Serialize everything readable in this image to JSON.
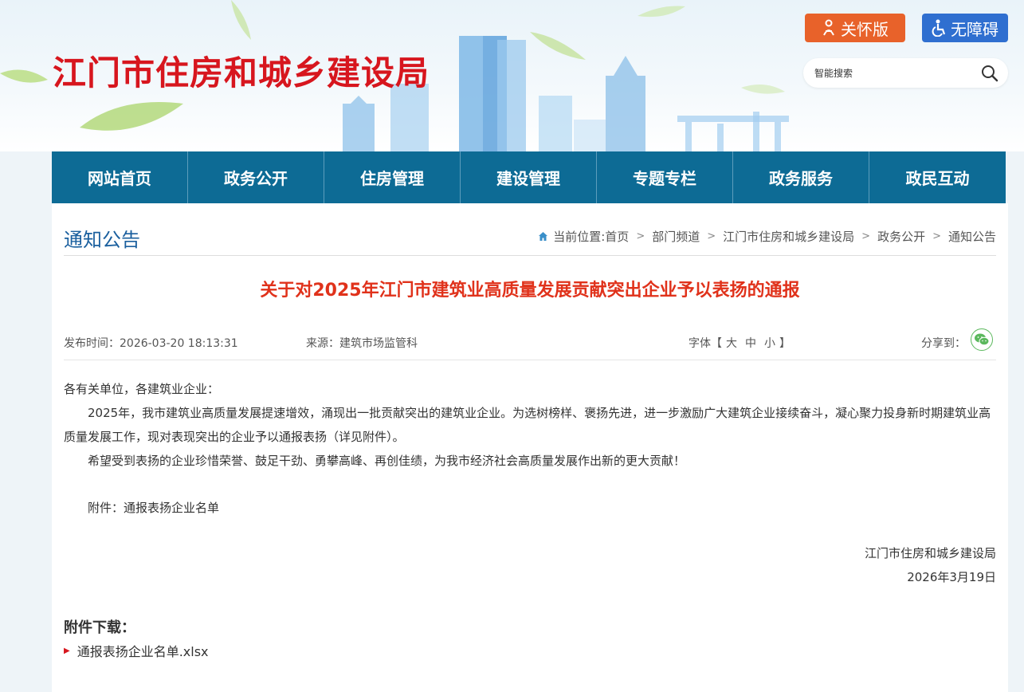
{
  "header": {
    "site_title": "江门市住房和城乡建设局",
    "care_button": "关怀版",
    "access_button": "无障碍",
    "search_placeholder": "智能搜索"
  },
  "nav": {
    "items": [
      "网站首页",
      "政务公开",
      "住房管理",
      "建设管理",
      "专题专栏",
      "政务服务",
      "政民互动"
    ]
  },
  "page": {
    "section_title": "通知公告",
    "breadcrumb_label": "当前位置:",
    "breadcrumb": [
      "首页",
      "部门频道",
      "江门市住房和城乡建设局",
      "政务公开",
      "通知公告"
    ],
    "breadcrumb_sep": ">"
  },
  "article": {
    "title": "关于对2025年江门市建筑业高质量发展贡献突出企业予以表扬的通报",
    "publish_time": "发布时间：2026-03-20 18:13:31",
    "source": "来源：建筑市场监管科",
    "font_label": "字体【",
    "font_sizes": [
      "大",
      "中",
      "小"
    ],
    "font_label_end": "】",
    "share_label": "分享到：",
    "greeting": "各有关单位，各建筑业企业：",
    "paragraph1": "2025年，我市建筑业高质量发展提速增效，涌现出一批贡献突出的建筑业企业。为选树榜样、褒扬先进，进一步激励广大建筑企业接续奋斗，凝心聚力投身新时期建筑业高质量发展工作，现对表现突出的企业予以通报表扬（详见附件）。",
    "paragraph2": "希望受到表扬的企业珍惜荣誉、鼓足干劲、勇攀高峰、再创佳绩，为我市经济社会高质量发展作出新的更大贡献！",
    "attachment_line": "附件：通报表扬企业名单",
    "signature_org": "江门市住房和城乡建设局",
    "signature_date": "2026年3月19日"
  },
  "downloads": {
    "title": "附件下载：",
    "files": [
      "通报表扬企业名单.xlsx"
    ]
  },
  "colors": {
    "brand_red": "#d7161e",
    "nav_blue": "#0d6b95",
    "care_orange": "#e8622a",
    "access_blue": "#2f6fd0",
    "title_red": "#e0321b"
  }
}
